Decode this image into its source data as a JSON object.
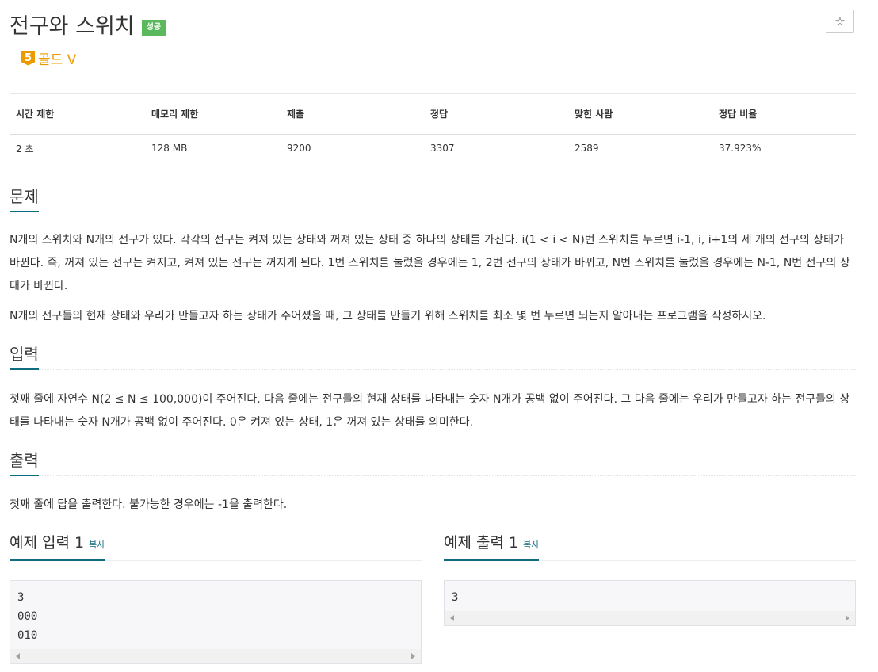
{
  "problem": {
    "title": "전구와 스위치",
    "result_badge": "성공",
    "star_icon": "☆",
    "tier_number": "5",
    "tier_label": "골드 V",
    "tier_color": "#ec9a00",
    "badge_color": "#5cb85c"
  },
  "info_table": {
    "headers": [
      "시간 제한",
      "메모리 제한",
      "제출",
      "정답",
      "맞힌 사람",
      "정답 비율"
    ],
    "values": [
      "2 초",
      "128 MB",
      "9200",
      "3307",
      "2589",
      "37.923%"
    ]
  },
  "sections": {
    "description": {
      "title": "문제",
      "paragraphs": [
        "N개의 스위치와 N개의 전구가 있다. 각각의 전구는 켜져 있는 상태와 꺼져 있는 상태 중 하나의 상태를 가진다. i(1 < i < N)번 스위치를 누르면 i-1, i, i+1의 세 개의 전구의 상태가 바뀐다. 즉, 꺼져 있는 전구는 켜지고, 켜져 있는 전구는 꺼지게 된다. 1번 스위치를 눌렀을 경우에는 1, 2번 전구의 상태가 바뀌고, N번 스위치를 눌렀을 경우에는 N-1, N번 전구의 상태가 바뀐다.",
        "N개의 전구들의 현재 상태와 우리가 만들고자 하는 상태가 주어졌을 때, 그 상태를 만들기 위해 스위치를 최소 몇 번 누르면 되는지 알아내는 프로그램을 작성하시오."
      ]
    },
    "input": {
      "title": "입력",
      "paragraphs": [
        "첫째 줄에 자연수 N(2 ≤ N ≤ 100,000)이 주어진다. 다음 줄에는 전구들의 현재 상태를 나타내는 숫자 N개가 공백 없이 주어진다. 그 다음 줄에는 우리가 만들고자 하는 전구들의 상태를 나타내는 숫자 N개가 공백 없이 주어진다. 0은 켜져 있는 상태, 1은 꺼져 있는 상태를 의미한다."
      ]
    },
    "output": {
      "title": "출력",
      "paragraphs": [
        "첫째 줄에 답을 출력한다. 불가능한 경우에는 -1을 출력한다."
      ]
    }
  },
  "samples": {
    "input": {
      "title": "예제 입력 1",
      "copy_label": "복사",
      "content": "3\n000\n010"
    },
    "output": {
      "title": "예제 출력 1",
      "copy_label": "복사",
      "content": "3"
    }
  },
  "accent_color": "#0f6b7e"
}
